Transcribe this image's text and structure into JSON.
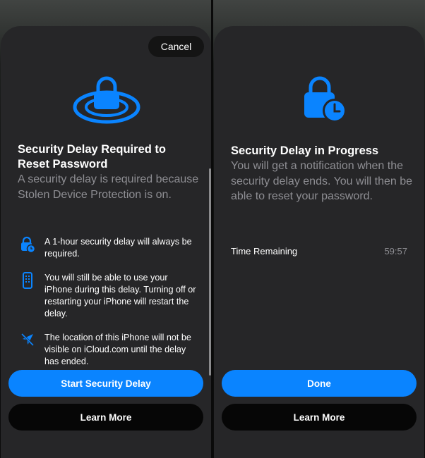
{
  "left_sheet": {
    "cancel_label": "Cancel",
    "title": "Security Delay Required to Reset Password",
    "subtitle": "A security delay is required because Stolen Device Protection is on.",
    "bullets": [
      {
        "icon": "lock-clock-icon",
        "text": "A 1-hour security delay will always be required."
      },
      {
        "icon": "iphone-icon",
        "text": "You will still be able to use your iPhone during this delay. Turning off or restarting your iPhone will restart the delay."
      },
      {
        "icon": "location-slash-icon",
        "text": "The location of this iPhone will not be visible on iCloud.com until the delay has ended."
      }
    ],
    "primary_label": "Start Security Delay",
    "secondary_label": "Learn More"
  },
  "right_sheet": {
    "title": "Security Delay in Progress",
    "subtitle": "You will get a notification when the security delay ends. You will then be able to reset your password.",
    "time_label": "Time Remaining",
    "time_value": "59:57",
    "primary_label": "Done",
    "secondary_label": "Learn More"
  },
  "colors": {
    "accent": "#0a84ff",
    "sheet": "#262628",
    "secondary_text": "#8e8e93"
  }
}
